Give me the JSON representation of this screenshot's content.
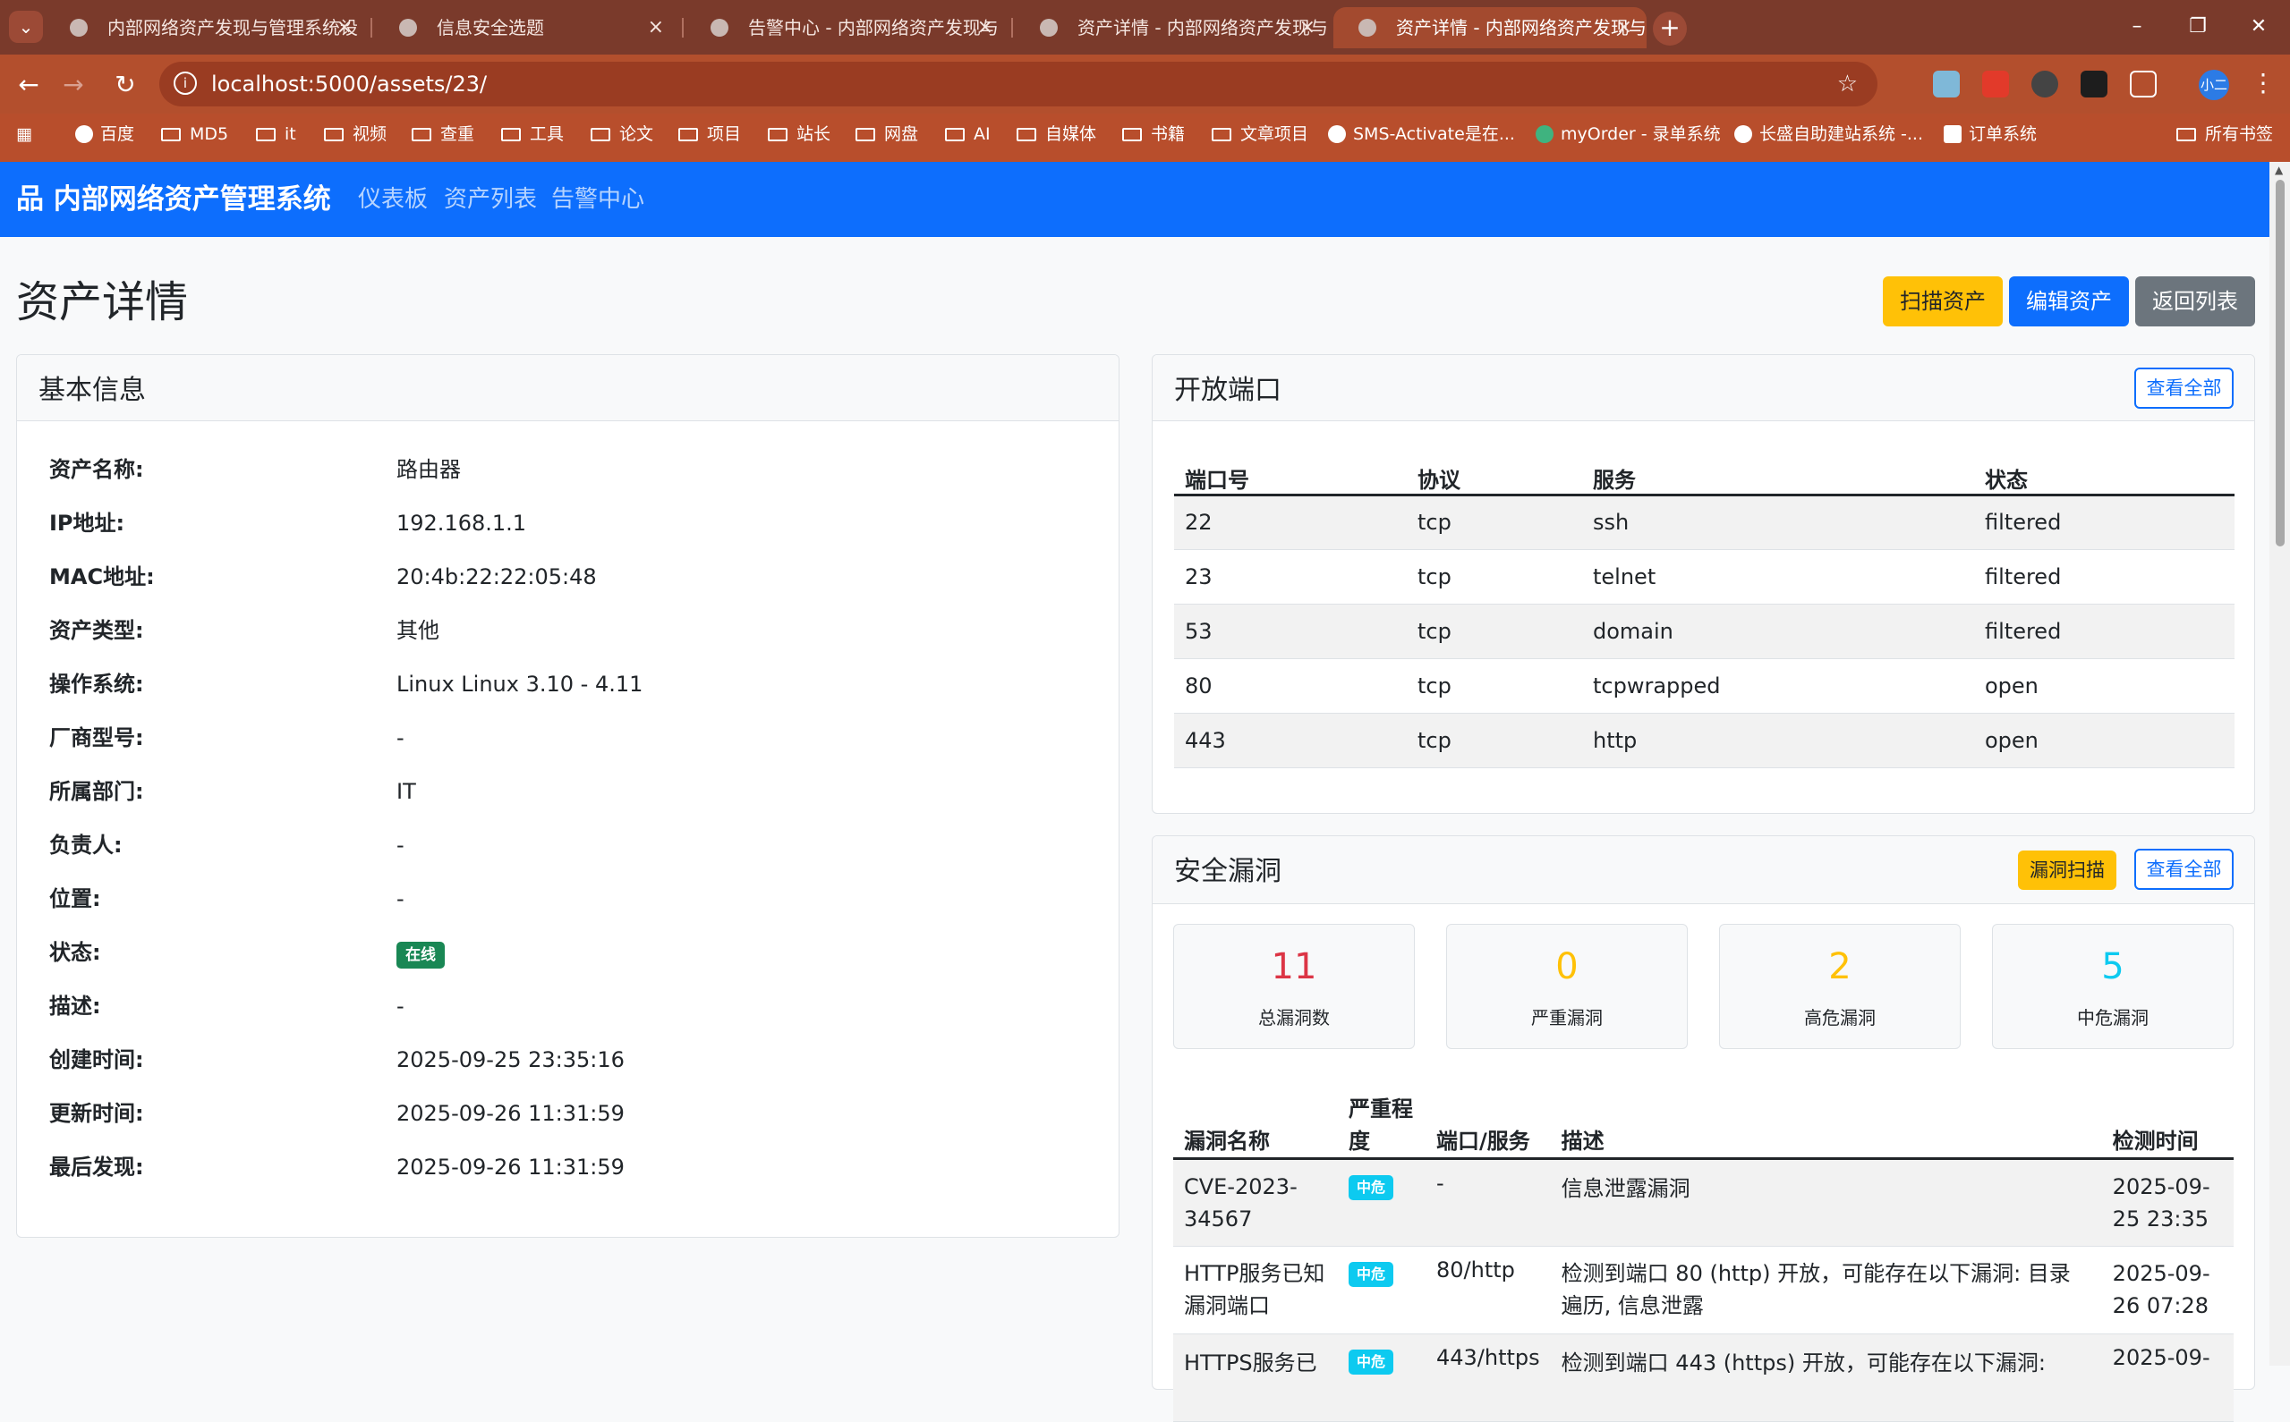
{
  "browser": {
    "tabs": [
      {
        "title": "内部网络资产发现与管理系统设"
      },
      {
        "title": "信息安全选题"
      },
      {
        "title": "告警中心 - 内部网络资产发现与"
      },
      {
        "title": "资产详情 - 内部网络资产发现与"
      },
      {
        "title": "资产详情 - 内部网络资产发现与"
      }
    ],
    "url": "localhost:5000/assets/23/",
    "avatar_label": "小二",
    "bookmarks": [
      "百度",
      "MD5",
      "it",
      "视频",
      "查重",
      "工具",
      "论文",
      "项目",
      "站长",
      "网盘",
      "AI",
      "自媒体",
      "书籍",
      "文章项目",
      "SMS-Activate是在...",
      "myOrder - 录单系统",
      "长盛自助建站系统 -...",
      "订单系统"
    ],
    "all_bookmarks": "所有书签"
  },
  "app": {
    "brand": "内部网络资产管理系统",
    "nav": [
      "仪表板",
      "资产列表",
      "告警中心"
    ]
  },
  "page": {
    "title": "资产详情",
    "buttons": {
      "scan": "扫描资产",
      "edit": "编辑资产",
      "back": "返回列表"
    }
  },
  "basic_info": {
    "header": "基本信息",
    "rows": [
      {
        "label": "资产名称:",
        "value": "路由器"
      },
      {
        "label": "IP地址:",
        "value": "192.168.1.1"
      },
      {
        "label": "MAC地址:",
        "value": "20:4b:22:22:05:48"
      },
      {
        "label": "资产类型:",
        "value": "其他"
      },
      {
        "label": "操作系统:",
        "value": "Linux Linux 3.10 - 4.11"
      },
      {
        "label": "厂商型号:",
        "value": "-"
      },
      {
        "label": "所属部门:",
        "value": "IT"
      },
      {
        "label": "负责人:",
        "value": "-"
      },
      {
        "label": "位置:",
        "value": "-"
      },
      {
        "label": "状态:",
        "value": "在线"
      },
      {
        "label": "描述:",
        "value": "-"
      },
      {
        "label": "创建时间:",
        "value": "2025-09-25 23:35:16"
      },
      {
        "label": "更新时间:",
        "value": "2025-09-26 11:31:59"
      },
      {
        "label": "最后发现:",
        "value": "2025-09-26 11:31:59"
      }
    ]
  },
  "ports": {
    "header": "开放端口",
    "view_all": "查看全部",
    "columns": [
      "端口号",
      "协议",
      "服务",
      "状态"
    ],
    "rows": [
      [
        "22",
        "tcp",
        "ssh",
        "filtered"
      ],
      [
        "23",
        "tcp",
        "telnet",
        "filtered"
      ],
      [
        "53",
        "tcp",
        "domain",
        "filtered"
      ],
      [
        "80",
        "tcp",
        "tcpwrapped",
        "open"
      ],
      [
        "443",
        "tcp",
        "http",
        "open"
      ]
    ]
  },
  "vulns": {
    "header": "安全漏洞",
    "scan_btn": "漏洞扫描",
    "view_all": "查看全部",
    "stats": [
      {
        "num": "11",
        "label": "总漏洞数",
        "color": "#dc3545"
      },
      {
        "num": "0",
        "label": "严重漏洞",
        "color": "#ffc107"
      },
      {
        "num": "2",
        "label": "高危漏洞",
        "color": "#ffc107"
      },
      {
        "num": "5",
        "label": "中危漏洞",
        "color": "#0dcaf0"
      }
    ],
    "columns": [
      "漏洞名称",
      "严重程度",
      "端口/服务",
      "描述",
      "检测时间"
    ],
    "rows": [
      {
        "name": "CVE-2023-34567",
        "severity": "中危",
        "port": "-",
        "desc": "信息泄露漏洞",
        "time": "2025-09-25 23:35"
      },
      {
        "name": "HTTP服务已知漏洞端口",
        "severity": "中危",
        "port": "80/http",
        "desc": "检测到端口 80 (http) 开放，可能存在以下漏洞: 目录遍历, 信息泄露",
        "time": "2025-09-26 07:28"
      },
      {
        "name": "HTTPS服务已",
        "severity": "中危",
        "port": "443/https",
        "desc": "检测到端口 443 (https) 开放，可能存在以下漏洞:",
        "time": "2025-09-"
      }
    ]
  }
}
